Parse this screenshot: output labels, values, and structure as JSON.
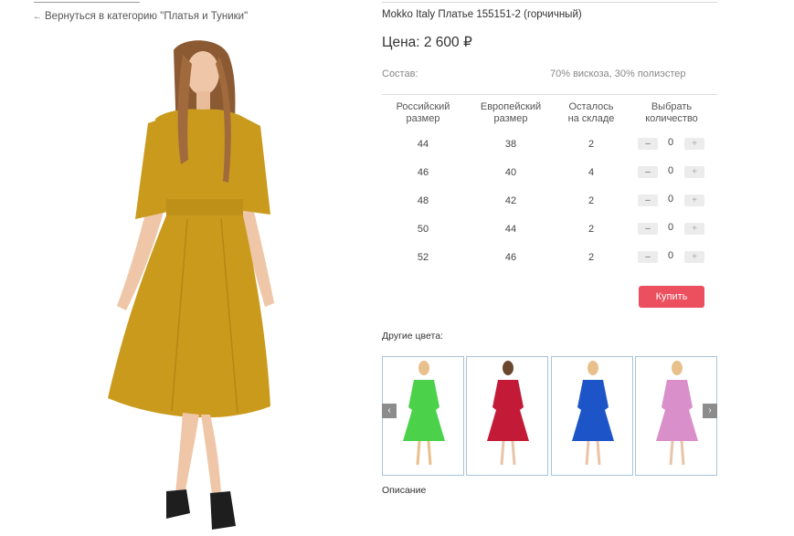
{
  "nav": {
    "back_arrow": "←",
    "back_link": "Вернуться в категорию \"Платья и Туники\""
  },
  "product": {
    "title": "Mokko Italy Платье 155151-2 (горчичный)",
    "price": "Цена: 2 600 ₽",
    "composition_label": "Состав:",
    "composition_value": "70% вискоза, 30% полиэстер",
    "main_color": "#c99a1c"
  },
  "size_table": {
    "headers": {
      "ru_size": [
        "Российский",
        "размер"
      ],
      "eu_size": [
        "Европейский",
        "размер"
      ],
      "stock": [
        "Осталось",
        "на складе"
      ],
      "qty": [
        "Выбрать",
        "количество"
      ]
    },
    "rows": [
      {
        "ru": "44",
        "eu": "38",
        "stock": "2",
        "qty": "0"
      },
      {
        "ru": "46",
        "eu": "40",
        "stock": "4",
        "qty": "0"
      },
      {
        "ru": "48",
        "eu": "42",
        "stock": "2",
        "qty": "0"
      },
      {
        "ru": "50",
        "eu": "44",
        "stock": "2",
        "qty": "0"
      },
      {
        "ru": "52",
        "eu": "46",
        "stock": "2",
        "qty": "0"
      }
    ],
    "minus_label": "–",
    "plus_label": "+"
  },
  "buy_button": "Купить",
  "other_colors": {
    "label": "Другие цвета:",
    "prev_icon": "‹",
    "next_icon": "›",
    "thumbs": [
      {
        "name": "green",
        "color": "#4bd14a"
      },
      {
        "name": "red",
        "color": "#c21a37"
      },
      {
        "name": "blue",
        "color": "#1d54c8"
      },
      {
        "name": "lilac",
        "color": "#d98fc9"
      }
    ]
  },
  "description_label": "Описание"
}
